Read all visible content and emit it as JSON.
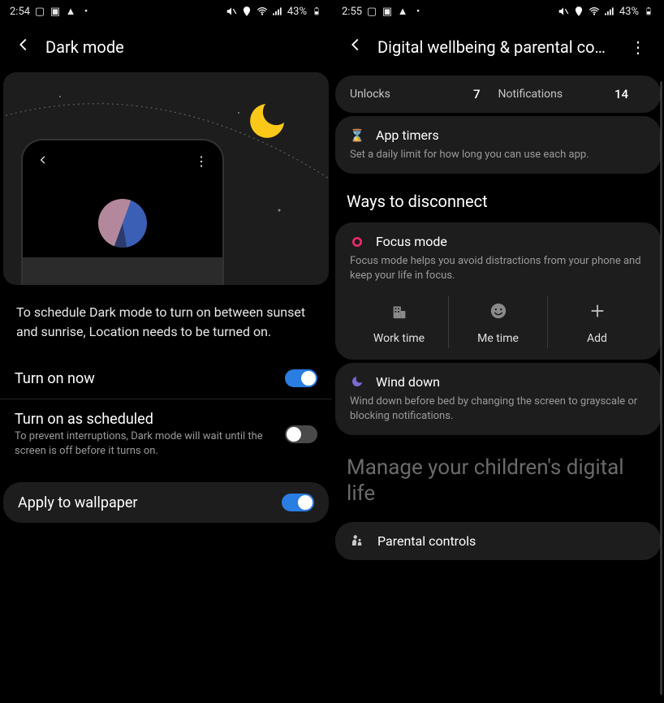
{
  "screen1": {
    "status": {
      "time": "2:54",
      "battery": "43%"
    },
    "title": "Dark mode",
    "info": "To schedule Dark mode to turn on between sunset and sunrise, Location needs to be turned on.",
    "rows": {
      "turn_on_now": {
        "label": "Turn on now"
      },
      "scheduled": {
        "label": "Turn on as scheduled",
        "sub": "To prevent interruptions, Dark mode will wait until the screen is off before it turns on."
      },
      "wallpaper": {
        "label": "Apply to wallpaper"
      }
    }
  },
  "screen2": {
    "status": {
      "time": "2:55",
      "battery": "43%"
    },
    "title": "Digital wellbeing & parental con...",
    "stats": {
      "unlocks_label": "Unlocks",
      "unlocks": "7",
      "notif_label": "Notifications",
      "notif": "14"
    },
    "app_timers": {
      "title": "App timers",
      "sub": "Set a daily limit for how long you can use each app."
    },
    "ways_title": "Ways to disconnect",
    "focus": {
      "title": "Focus mode",
      "sub": "Focus mode helps you avoid distractions from your phone and keep your life in focus.",
      "cols": {
        "work": "Work time",
        "me": "Me time",
        "add": "Add"
      }
    },
    "wind": {
      "title": "Wind down",
      "sub": "Wind down before bed by changing the screen to grayscale or blocking notifications."
    },
    "manage": "Manage your children's digital life",
    "parental": "Parental controls"
  }
}
